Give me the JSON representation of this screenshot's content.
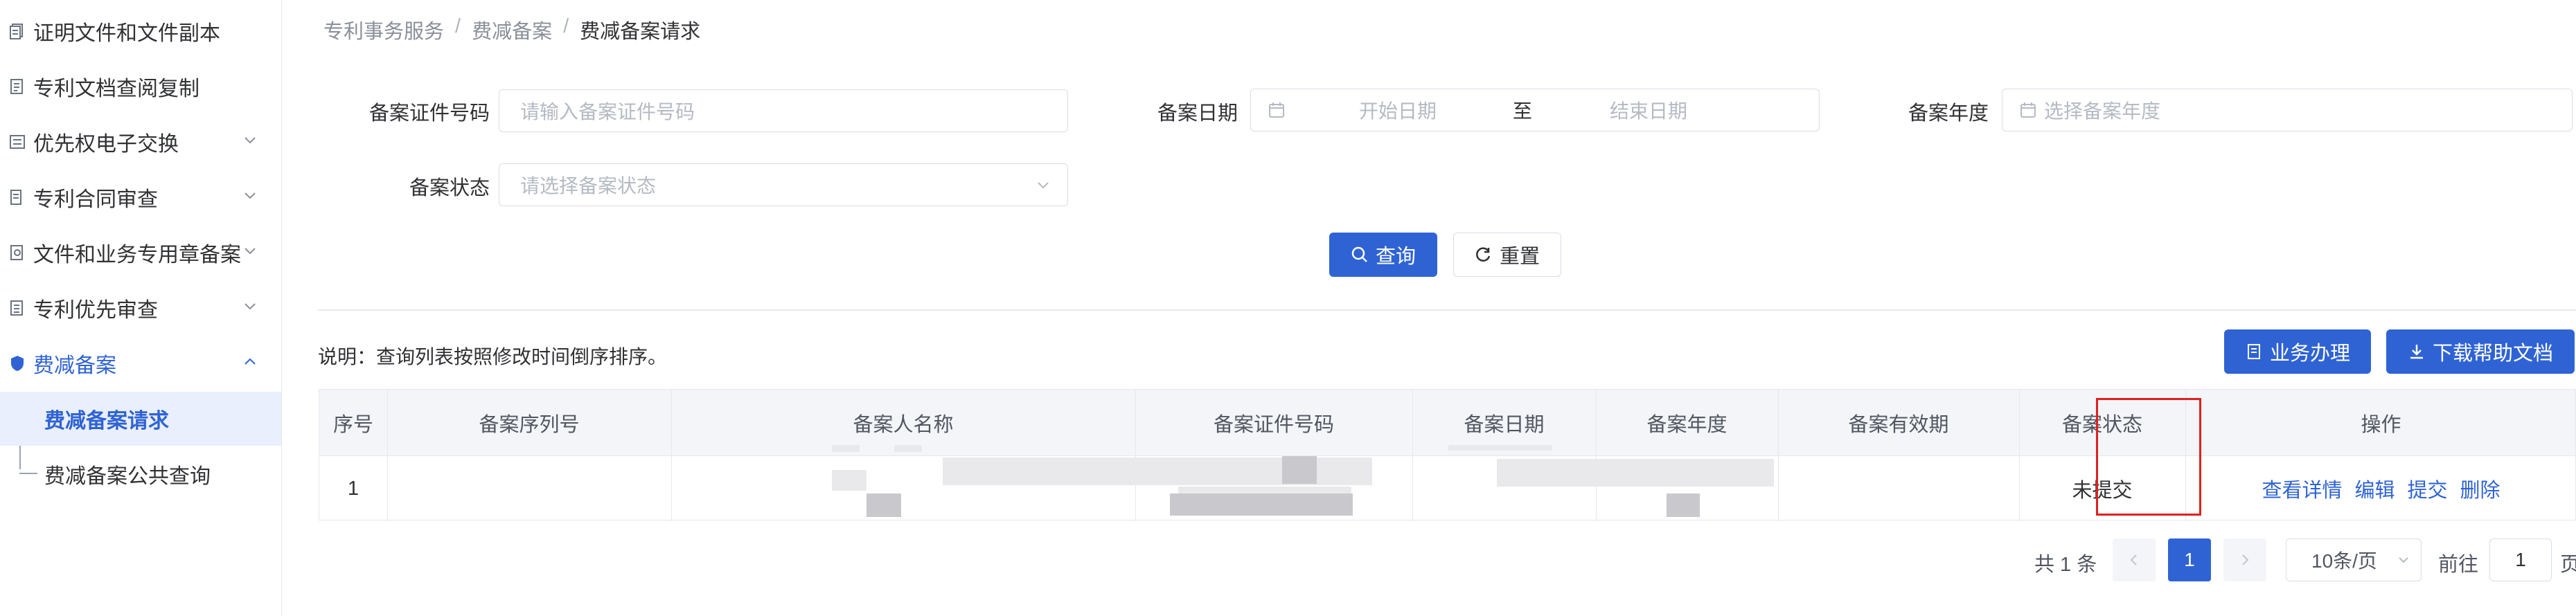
{
  "sidebar": {
    "items": [
      {
        "label": "证明文件和文件副本",
        "icon": "document-stack-icon",
        "expandable": false
      },
      {
        "label": "专利文档查阅复制",
        "icon": "document-icon",
        "expandable": false
      },
      {
        "label": "优先权电子交换",
        "icon": "exchange-icon",
        "expandable": true
      },
      {
        "label": "专利合同审查",
        "icon": "contract-icon",
        "expandable": true
      },
      {
        "label": "文件和业务专用章备案",
        "icon": "seal-icon",
        "expandable": true
      },
      {
        "label": "专利优先审查",
        "icon": "priority-icon",
        "expandable": true
      },
      {
        "label": "费减备案",
        "icon": "shield-icon",
        "expandable": true,
        "expanded": true,
        "active": true
      }
    ],
    "sub_items": [
      {
        "label": "费减备案请求",
        "active": true
      },
      {
        "label": "费减备案公共查询",
        "active": false
      }
    ]
  },
  "breadcrumb": [
    "专利事务服务",
    "费减备案",
    "费减备案请求"
  ],
  "breadcrumb_separator": "/",
  "form": {
    "cert_no_label": "备案证件号码",
    "cert_no_placeholder": "请输入备案证件号码",
    "date_label": "备案日期",
    "date_start_placeholder": "开始日期",
    "date_range_sep": "至",
    "date_end_placeholder": "结束日期",
    "year_label": "备案年度",
    "year_placeholder": "选择备案年度",
    "status_label": "备案状态",
    "status_placeholder": "请选择备案状态",
    "query_button": "查询",
    "reset_button": "重置"
  },
  "note": "说明：查询列表按照修改时间倒序排序。",
  "actions": {
    "business_button": "业务办理",
    "download_button": "下载帮助文档"
  },
  "table": {
    "columns": [
      "序号",
      "备案序列号",
      "备案人名称",
      "备案证件号码",
      "备案日期",
      "备案年度",
      "备案有效期",
      "备案状态",
      "操作"
    ],
    "rows": [
      {
        "index": "1",
        "serial": "",
        "name": "",
        "cert_no": "",
        "date": "",
        "year": "",
        "validity": "",
        "status": "未提交",
        "ops": [
          "查看详情",
          "编辑",
          "提交",
          "删除"
        ]
      }
    ]
  },
  "pagination": {
    "total": "共 1 条",
    "current_page": "1",
    "page_size": "10条/页",
    "goto_label": "前往",
    "goto_value": "1",
    "page_suffix": "页"
  },
  "colors": {
    "primary": "#2f63d4",
    "highlight_box": "#e02020",
    "active_bg": "#e9effc"
  }
}
